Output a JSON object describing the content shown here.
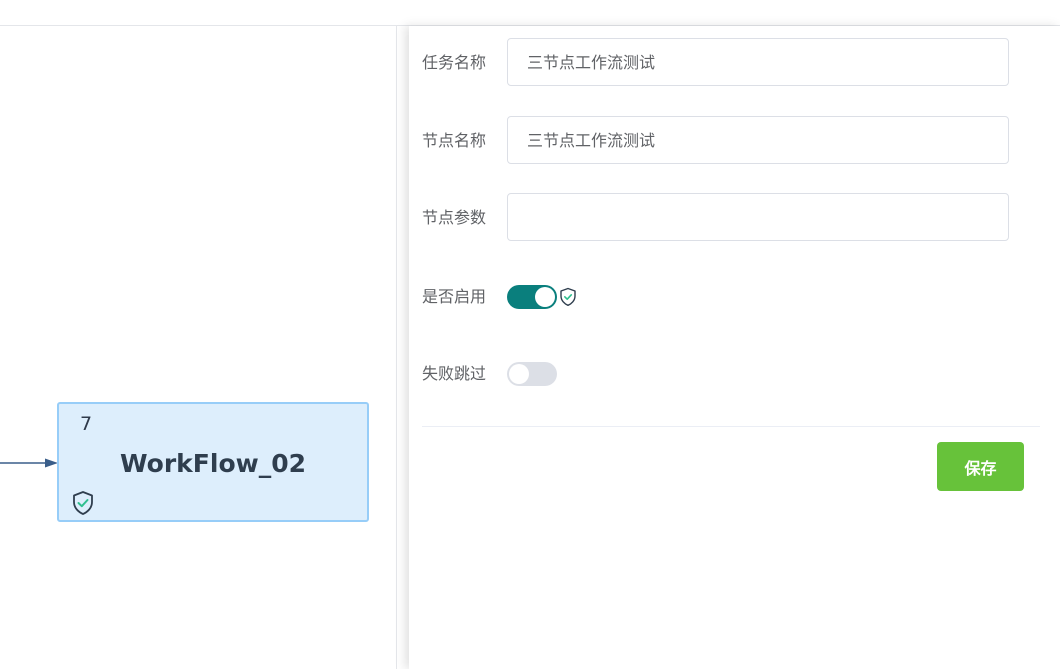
{
  "node": {
    "index": "7",
    "title": "WorkFlow_02",
    "status_icon": "shield-check-icon"
  },
  "form": {
    "task_name": {
      "label": "任务名称",
      "value": "三节点工作流测试"
    },
    "node_name": {
      "label": "节点名称",
      "value": "三节点工作流测试"
    },
    "node_params": {
      "label": "节点参数",
      "value": ""
    },
    "enabled": {
      "label": "是否启用",
      "on": true,
      "status_icon": "shield-check-icon"
    },
    "skip_on_failure": {
      "label": "失败跳过",
      "on": false
    }
  },
  "actions": {
    "save_label": "保存"
  },
  "colors": {
    "switch_on": "#0a7f7d",
    "switch_off": "#dcdfe6",
    "save_button": "#67c23a",
    "node_fill": "#ddeefc",
    "node_border": "#97cdf8",
    "shield_check": "#2fbf8f"
  }
}
